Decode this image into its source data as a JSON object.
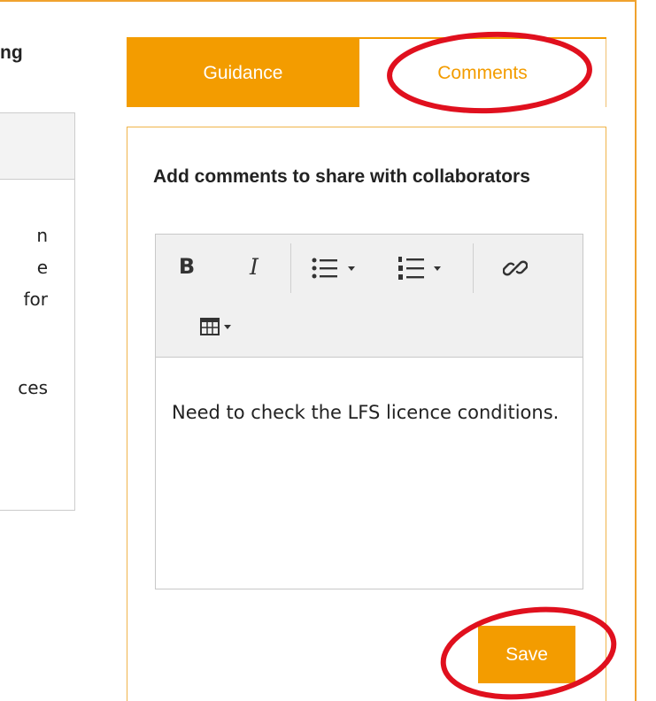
{
  "left_panel": {
    "heading_fragment": "ng",
    "text_fragments": [
      "n",
      "e",
      "for",
      "ces"
    ]
  },
  "tabs": [
    {
      "label": "Guidance",
      "active": false
    },
    {
      "label": "Comments",
      "active": true
    }
  ],
  "comments": {
    "title": "Add comments to share with collaborators",
    "editor_text": "Need to check the LFS licence conditions.",
    "save_label": "Save"
  },
  "toolbar": {
    "bold_glyph": "B",
    "italic_glyph": "I",
    "icons": [
      "bold-icon",
      "italic-icon",
      "bullet-list-icon",
      "numbered-list-icon",
      "link-icon",
      "table-icon"
    ]
  },
  "colors": {
    "accent": "#f39c00",
    "annotation": "#e0101e",
    "panel_border": "#f0b44a"
  }
}
